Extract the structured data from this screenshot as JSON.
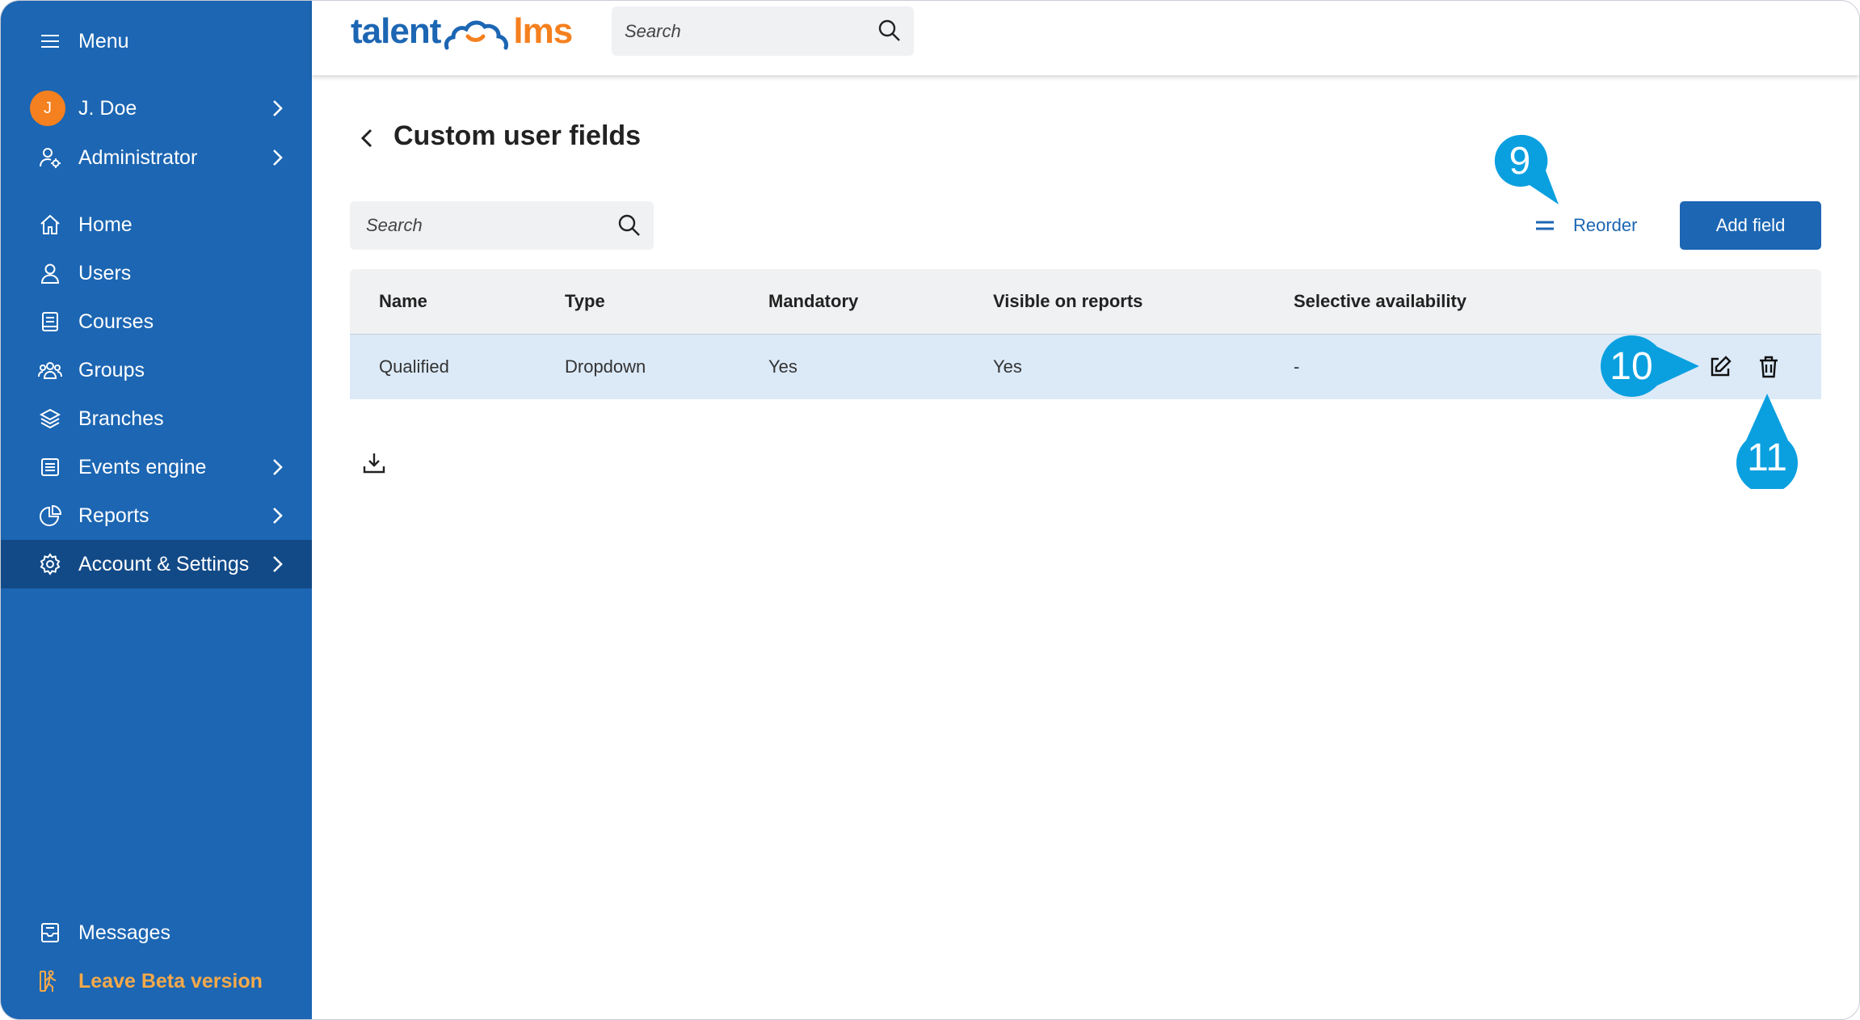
{
  "sidebar": {
    "menu_label": "Menu",
    "user": {
      "initial": "J",
      "name": "J. Doe"
    },
    "role": "Administrator",
    "items": [
      {
        "label": "Home",
        "icon": "home-icon"
      },
      {
        "label": "Users",
        "icon": "user-icon"
      },
      {
        "label": "Courses",
        "icon": "book-icon"
      },
      {
        "label": "Groups",
        "icon": "groups-icon"
      },
      {
        "label": "Branches",
        "icon": "layers-icon"
      },
      {
        "label": "Events engine",
        "icon": "events-icon"
      },
      {
        "label": "Reports",
        "icon": "pie-chart-icon"
      },
      {
        "label": "Account & Settings",
        "icon": "gear-icon"
      }
    ],
    "messages": "Messages",
    "leave_beta": "Leave Beta version",
    "colors": {
      "background": "#1c66b3",
      "active": "#124a87",
      "beta": "#f5a94a"
    }
  },
  "topbar": {
    "logo_left": "talent",
    "logo_right": "lms",
    "search_placeholder": "Search"
  },
  "page": {
    "title": "Custom user fields",
    "search_placeholder": "Search",
    "reorder_label": "Reorder",
    "add_field_label": "Add field"
  },
  "table": {
    "headers": [
      "Name",
      "Type",
      "Mandatory",
      "Visible on reports",
      "Selective availability"
    ],
    "rows": [
      [
        "Qualified",
        "Dropdown",
        "Yes",
        "Yes",
        "-"
      ]
    ]
  },
  "callouts": [
    "9",
    "10",
    "11"
  ],
  "colors": {
    "accent": "#1c66b3",
    "callout": "#0aa0e0",
    "row_highlight": "#dceaf8"
  }
}
